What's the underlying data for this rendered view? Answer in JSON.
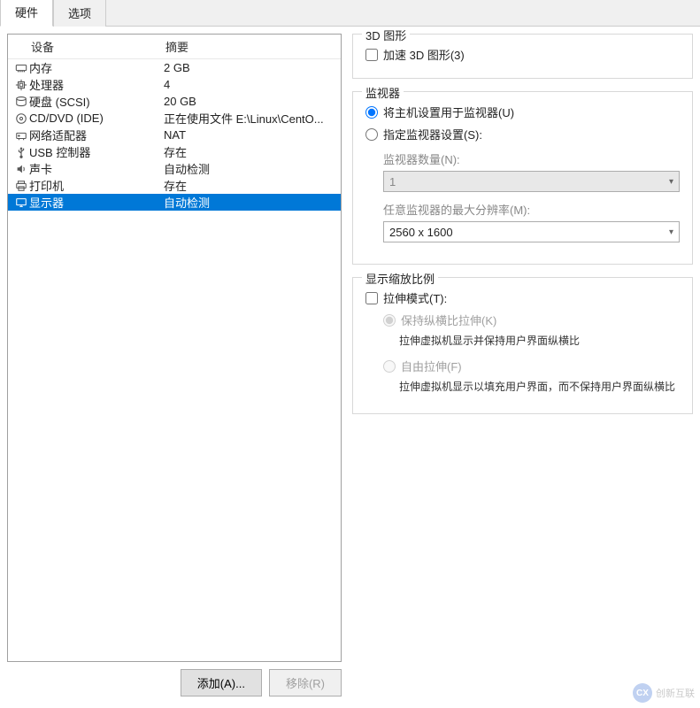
{
  "tabs": {
    "hardware": "硬件",
    "options": "选项"
  },
  "headers": {
    "device": "设备",
    "summary": "摘要"
  },
  "hw": [
    {
      "icon": "memory-icon",
      "name": "内存",
      "summary": "2 GB"
    },
    {
      "icon": "cpu-icon",
      "name": "处理器",
      "summary": "4"
    },
    {
      "icon": "disk-icon",
      "name": "硬盘 (SCSI)",
      "summary": "20 GB"
    },
    {
      "icon": "cd-icon",
      "name": "CD/DVD (IDE)",
      "summary": "正在使用文件 E:\\Linux\\CentO..."
    },
    {
      "icon": "network-icon",
      "name": "网络适配器",
      "summary": "NAT"
    },
    {
      "icon": "usb-icon",
      "name": "USB 控制器",
      "summary": "存在"
    },
    {
      "icon": "sound-icon",
      "name": "声卡",
      "summary": "自动检测"
    },
    {
      "icon": "printer-icon",
      "name": "打印机",
      "summary": "存在"
    },
    {
      "icon": "display-icon",
      "name": "显示器",
      "summary": "自动检测",
      "selected": true
    }
  ],
  "buttons": {
    "add": "添加(A)...",
    "remove": "移除(R)"
  },
  "group_3d": {
    "title": "3D 图形",
    "accelerate": "加速 3D 图形(3)"
  },
  "group_monitor": {
    "title": "监视器",
    "use_host": "将主机设置用于监视器(U)",
    "specify": "指定监视器设置(S):",
    "count_label": "监视器数量(N):",
    "count_value": "1",
    "maxres_label": "任意监视器的最大分辨率(M):",
    "maxres_value": "2560 x 1600"
  },
  "group_scale": {
    "title": "显示缩放比例",
    "stretch_mode": "拉伸模式(T):",
    "keep_aspect": "保持纵横比拉伸(K)",
    "keep_aspect_desc": "拉伸虚拟机显示并保持用户界面纵横比",
    "free_stretch": "自由拉伸(F)",
    "free_stretch_desc": "拉伸虚拟机显示以填充用户界面，而不保持用户界面纵横比"
  },
  "watermark": "创新互联"
}
